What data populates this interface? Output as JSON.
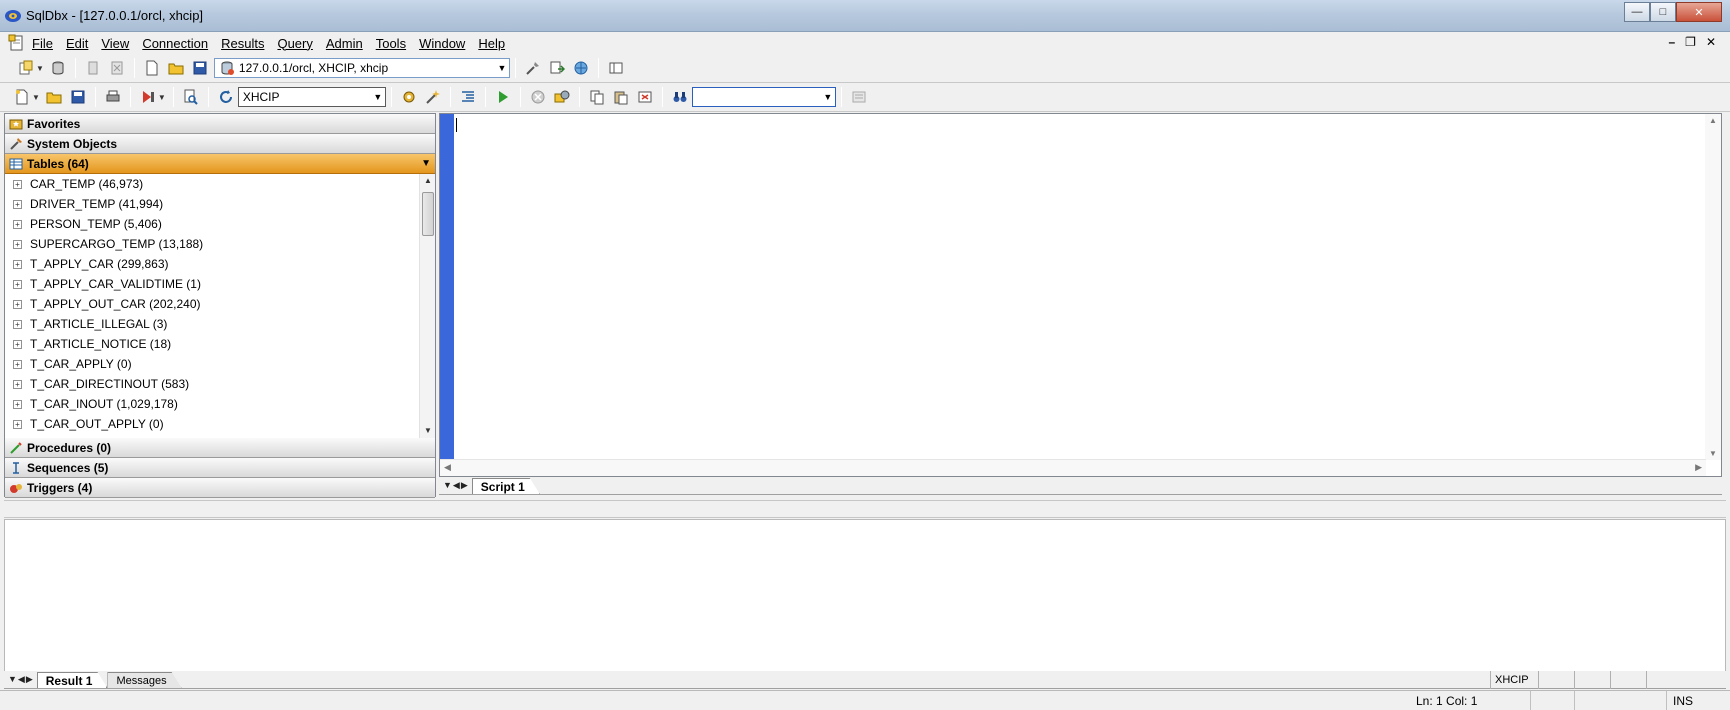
{
  "window": {
    "title": "SqlDbx - [127.0.0.1/orcl, xhcip]",
    "controls": {
      "minimize": "—",
      "maximize": "□",
      "close": "✕"
    }
  },
  "menu": {
    "items": [
      "File",
      "Edit",
      "View",
      "Connection",
      "Results",
      "Query",
      "Admin",
      "Tools",
      "Window",
      "Help"
    ],
    "mdi_controls": [
      "–",
      "❐",
      "✕"
    ]
  },
  "toolbar1": {
    "connection_value": "127.0.0.1/orcl, XHCIP, xhcip"
  },
  "toolbar2": {
    "schema_value": "XHCIP",
    "search_value": ""
  },
  "object_browser": {
    "sections_top": [
      {
        "label": "Favorites",
        "icon": "star-folder-icon"
      },
      {
        "label": "System Objects",
        "icon": "wrench-icon"
      },
      {
        "label": "Tables (64)",
        "icon": "table-icon",
        "active": true
      }
    ],
    "tables": [
      "CAR_TEMP (46,973)",
      "DRIVER_TEMP (41,994)",
      "PERSON_TEMP (5,406)",
      "SUPERCARGO_TEMP (13,188)",
      "T_APPLY_CAR (299,863)",
      "T_APPLY_CAR_VALIDTIME (1)",
      "T_APPLY_OUT_CAR (202,240)",
      "T_ARTICLE_ILLEGAL (3)",
      "T_ARTICLE_NOTICE (18)",
      "T_CAR_APPLY (0)",
      "T_CAR_DIRECTINOUT (583)",
      "T_CAR_INOUT (1,029,178)",
      "T_CAR_OUT_APPLY (0)"
    ],
    "sections_bottom": [
      {
        "label": "Procedures (0)",
        "icon": "procedure-icon"
      },
      {
        "label": "Sequences (5)",
        "icon": "sequence-icon"
      },
      {
        "label": "Triggers (4)",
        "icon": "trigger-icon"
      }
    ]
  },
  "editor_tabs": {
    "nav": "▼◀▶",
    "tabs": [
      "Script 1"
    ]
  },
  "result_tabs": {
    "nav": "▼◀▶",
    "tabs": [
      "Result 1",
      "Messages"
    ],
    "schema": "XHCIP"
  },
  "status": {
    "position": "Ln: 1   Col: 1",
    "mode": "INS"
  },
  "colors": {
    "accent_active_section": "#e3961d",
    "editor_gutter": "#3a67d9"
  }
}
